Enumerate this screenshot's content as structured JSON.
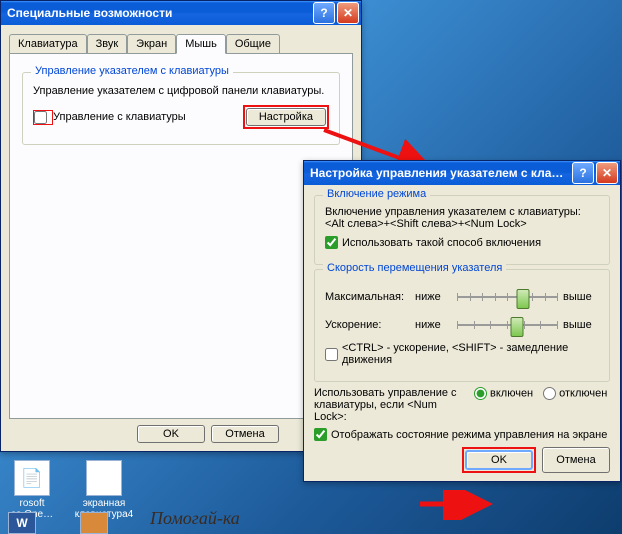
{
  "win1": {
    "title": "Специальные возможности",
    "tabs": [
      "Клавиатура",
      "Звук",
      "Экран",
      "Мышь",
      "Общие"
    ],
    "activeTab": 3,
    "group": {
      "caption": "Управление указателем с клавиатуры",
      "desc": "Управление указателем с цифровой панели клавиатуры.",
      "checkbox": "Управление с клавиатуры",
      "settingsBtn": "Настройка"
    },
    "ok": "OK",
    "cancel": "Отмена"
  },
  "win2": {
    "title": "Настройка управления указателем с клав…",
    "g1": {
      "caption": "Включение режима",
      "desc1": "Включение управления указателем с клавиатуры:",
      "desc2": "<Alt слева>+<Shift слева>+<Num Lock>",
      "checkbox": "Использовать такой способ включения"
    },
    "g2": {
      "caption": "Скорость перемещения указателя",
      "maxLabel": "Максимальная:",
      "accelLabel": "Ускорение:",
      "low": "ниже",
      "high": "выше",
      "ctrlShift": "<CTRL> - ускорение, <SHIFT> - замедление движения"
    },
    "numlock": {
      "text": "Использовать управление с клавиатуры, если <Num Lock>:",
      "on": "включен",
      "off": "отключен"
    },
    "showState": "Отображать состояние режима управления на экране",
    "ok": "OK",
    "cancel": "Отмена"
  },
  "desktop": {
    "icon1": "rosoft\nce One…",
    "icon2": "экранная\nклавиатура4"
  },
  "watermark": "Помогай-ка"
}
